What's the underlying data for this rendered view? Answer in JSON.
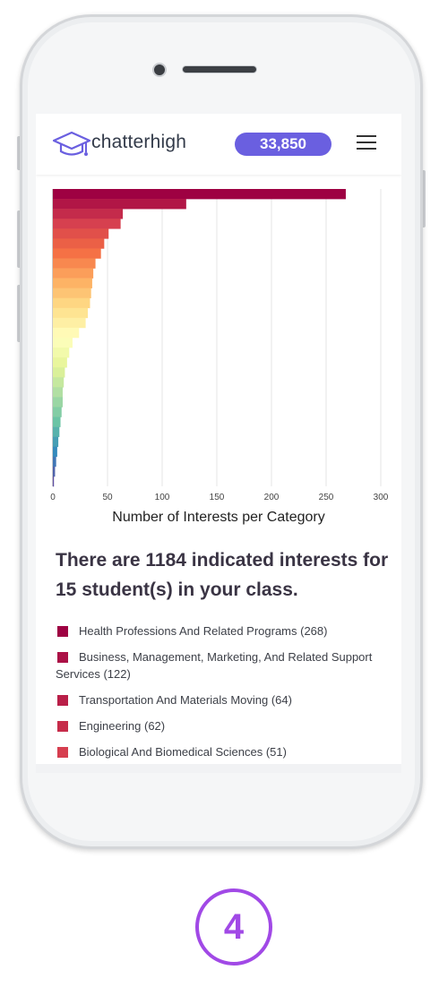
{
  "header": {
    "brand": "chatterhigh",
    "points": "33,850"
  },
  "chart_data": {
    "type": "bar",
    "orientation": "horizontal",
    "xlabel": "Number of Interests per Category",
    "xlim": [
      0,
      300
    ],
    "xticks": [
      0,
      50,
      100,
      150,
      200,
      250,
      300
    ],
    "values": [
      268,
      122,
      64,
      62,
      51,
      47,
      44,
      39,
      37,
      36,
      35,
      34,
      32,
      30,
      24,
      18,
      15,
      13,
      11,
      10,
      9,
      9,
      8,
      7,
      6,
      5,
      4,
      3,
      2,
      1
    ],
    "colormap": "spectral"
  },
  "summary": "There are 1184 indicated interests for 15 student(s) in your class.",
  "legend": [
    {
      "label": "Health Professions And Related Programs (268)",
      "color": "#9e0142"
    },
    {
      "label": "Business, Management, Marketing, And Related Support Services (122)",
      "color": "#ab1146"
    },
    {
      "label": "Transportation And Materials Moving (64)",
      "color": "#b91f48"
    },
    {
      "label": "Engineering (62)",
      "color": "#c62c4a"
    },
    {
      "label": "Biological And Biomedical Sciences (51)",
      "color": "#d63e4f"
    }
  ],
  "step_number": "4"
}
